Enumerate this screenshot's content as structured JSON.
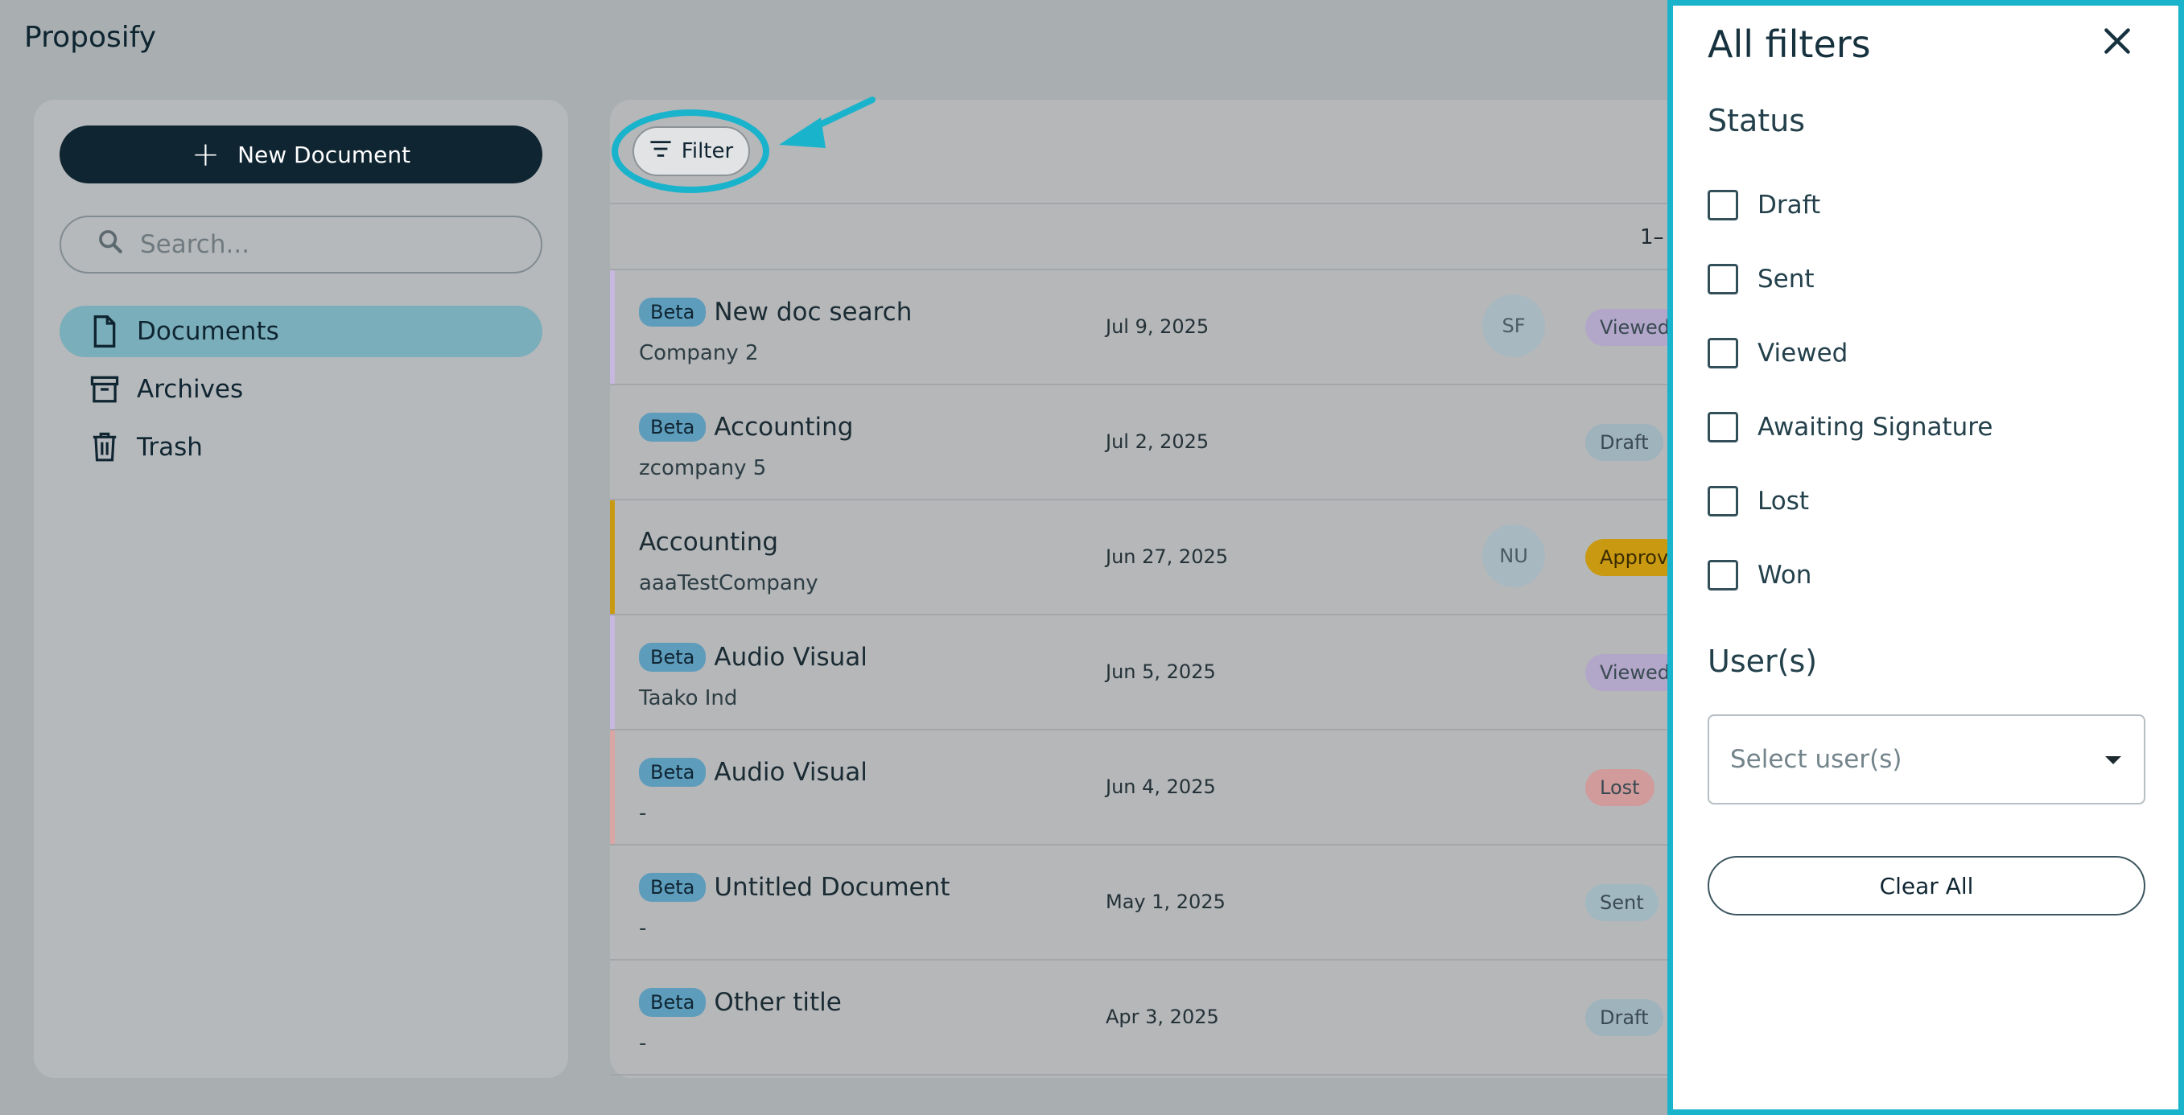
{
  "app": {
    "title": "Proposify"
  },
  "sidebar": {
    "new_document_label": "New Document",
    "search_placeholder": "Search...",
    "items": [
      {
        "label": "Documents",
        "icon": "document-icon",
        "active": true
      },
      {
        "label": "Archives",
        "icon": "archive-icon",
        "active": false
      },
      {
        "label": "Trash",
        "icon": "trash-icon",
        "active": false
      }
    ]
  },
  "toolbar": {
    "filter_label": "Filter",
    "pagination": "1–"
  },
  "documents": [
    {
      "badge": "Beta",
      "title": "New doc search",
      "company": "Company 2",
      "date": "Jul 9, 2025",
      "avatar": "SF",
      "status": "Viewed",
      "accent": "#c7b8e0"
    },
    {
      "badge": "Beta",
      "title": "Accounting",
      "company": "zcompany 5",
      "date": "Jul 2, 2025",
      "avatar": "",
      "status": "Draft",
      "accent": ""
    },
    {
      "badge": "",
      "title": "Accounting",
      "company": "aaaTestCompany",
      "date": "Jun 27, 2025",
      "avatar": "NU",
      "status": "Approv",
      "accent": "#c99a11"
    },
    {
      "badge": "Beta",
      "title": "Audio Visual",
      "company": "Taako Ind",
      "date": "Jun 5, 2025",
      "avatar": "",
      "status": "Viewed",
      "accent": "#c7b8e0"
    },
    {
      "badge": "Beta",
      "title": "Audio Visual",
      "company": "-",
      "date": "Jun 4, 2025",
      "avatar": "",
      "status": "Lost",
      "accent": "#d9a5a5"
    },
    {
      "badge": "Beta",
      "title": "Untitled Document",
      "company": "-",
      "date": "May 1, 2025",
      "avatar": "",
      "status": "Sent",
      "accent": ""
    },
    {
      "badge": "Beta",
      "title": "Other title",
      "company": "-",
      "date": "Apr 3, 2025",
      "avatar": "",
      "status": "Draft",
      "accent": ""
    }
  ],
  "filters_panel": {
    "title": "All filters",
    "status_heading": "Status",
    "status_options": [
      "Draft",
      "Sent",
      "Viewed",
      "Awaiting Signature",
      "Lost",
      "Won"
    ],
    "users_heading": "User(s)",
    "users_placeholder": "Select user(s)",
    "clear_all_label": "Clear All"
  },
  "colors": {
    "highlight": "#1ab3cc",
    "primary_dark": "#0f2532",
    "active_nav": "#7aaeba",
    "status_viewed": "#b2a6c9",
    "status_draft": "#9fb3bd",
    "status_approved": "#c99a11",
    "status_lost": "#d19b9b",
    "status_sent": "#a2b8c1"
  }
}
